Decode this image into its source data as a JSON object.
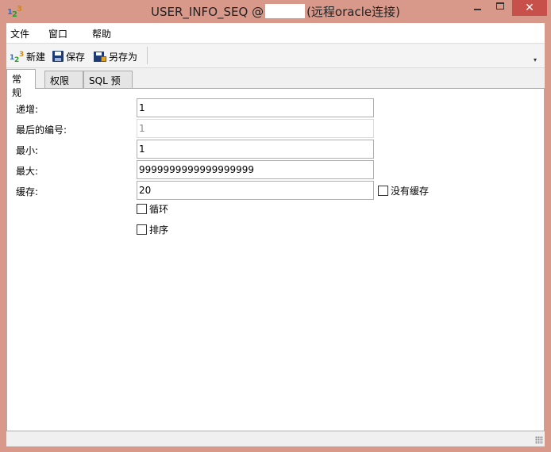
{
  "window": {
    "title_prefix": "USER_INFO_SEQ @",
    "title_suffix": "(远程oracle连接)",
    "minimize": "—",
    "close": "✕"
  },
  "menu": {
    "file": "文件",
    "window": "窗口",
    "help": "帮助"
  },
  "toolbar": {
    "new": "新建",
    "save": "保存",
    "save_as": "另存为",
    "overflow": "▾",
    "new_icon_digits": [
      "1",
      "2",
      "3"
    ]
  },
  "tabs": [
    {
      "label": "常规",
      "active": true
    },
    {
      "label": "权限",
      "active": false
    },
    {
      "label": "SQL 预览",
      "active": false
    }
  ],
  "form": {
    "increment_label": "递增:",
    "increment_value": "1",
    "last_number_label": "最后的编号:",
    "last_number_value": "1",
    "min_label": "最小:",
    "min_value": "1",
    "max_label": "最大:",
    "max_value": "9999999999999999999",
    "cache_label": "缓存:",
    "cache_value": "20",
    "no_cache_label": "没有缓存",
    "no_cache_checked": false,
    "cycle_label": "循环",
    "cycle_checked": false,
    "order_label": "排序",
    "order_checked": false
  },
  "colors": {
    "titlebar": "#d8998a",
    "close_button": "#c7504b"
  }
}
